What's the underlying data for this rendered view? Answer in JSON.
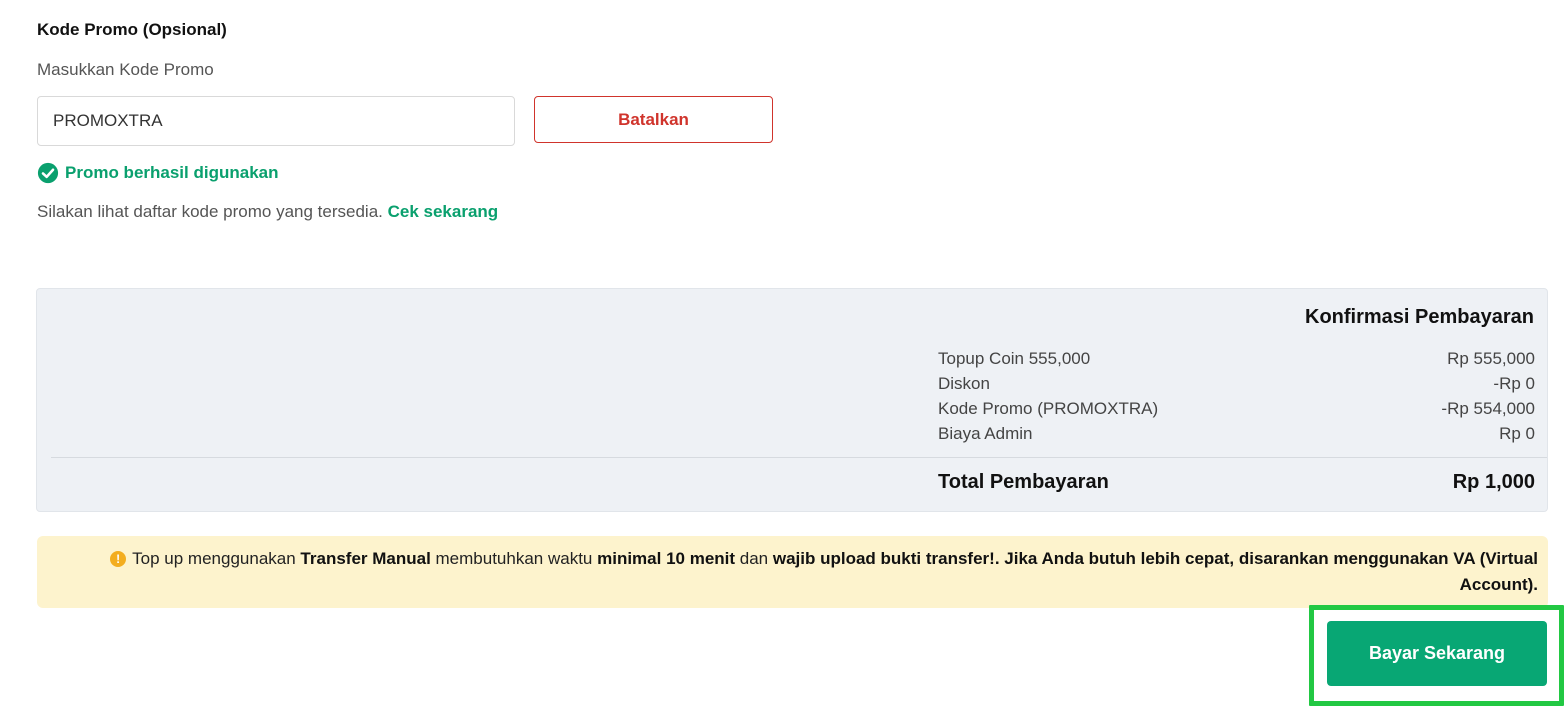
{
  "promo": {
    "title": "Kode Promo (Opsional)",
    "input_label": "Masukkan Kode Promo",
    "input_value": "PROMOXTRA",
    "cancel_label": "Batalkan",
    "success_text": "Promo berhasil digunakan",
    "hint_text": "Silakan lihat daftar kode promo yang tersedia.",
    "hint_link": "Cek sekarang",
    "success_color": "#0aa06e",
    "cancel_color": "#d0342c"
  },
  "summary": {
    "title": "Konfirmasi Pembayaran",
    "rows": [
      {
        "label": "Topup Coin 555,000",
        "value": "Rp 555,000"
      },
      {
        "label": "Diskon",
        "value": "-Rp 0"
      },
      {
        "label": "Kode Promo (PROMOXTRA)",
        "value": "-Rp 554,000"
      },
      {
        "label": "Biaya Admin",
        "value": "Rp 0"
      }
    ],
    "total_label": "Total Pembayaran",
    "total_value": "Rp 1,000"
  },
  "notice": {
    "icon": "warning-icon",
    "part1": "Top up menggunakan ",
    "bold1": "Transfer Manual",
    "part2": " membutuhkan waktu ",
    "bold2": "minimal 10 menit",
    "part3": " dan ",
    "bold3": "wajib upload bukti transfer!. Jika Anda butuh lebih cepat, disarankan menggunakan VA (Virtual Account).",
    "background": "#fdf3cd"
  },
  "pay": {
    "label": "Bayar Sekarang",
    "color": "#08a774",
    "highlight_color": "#22c843"
  }
}
